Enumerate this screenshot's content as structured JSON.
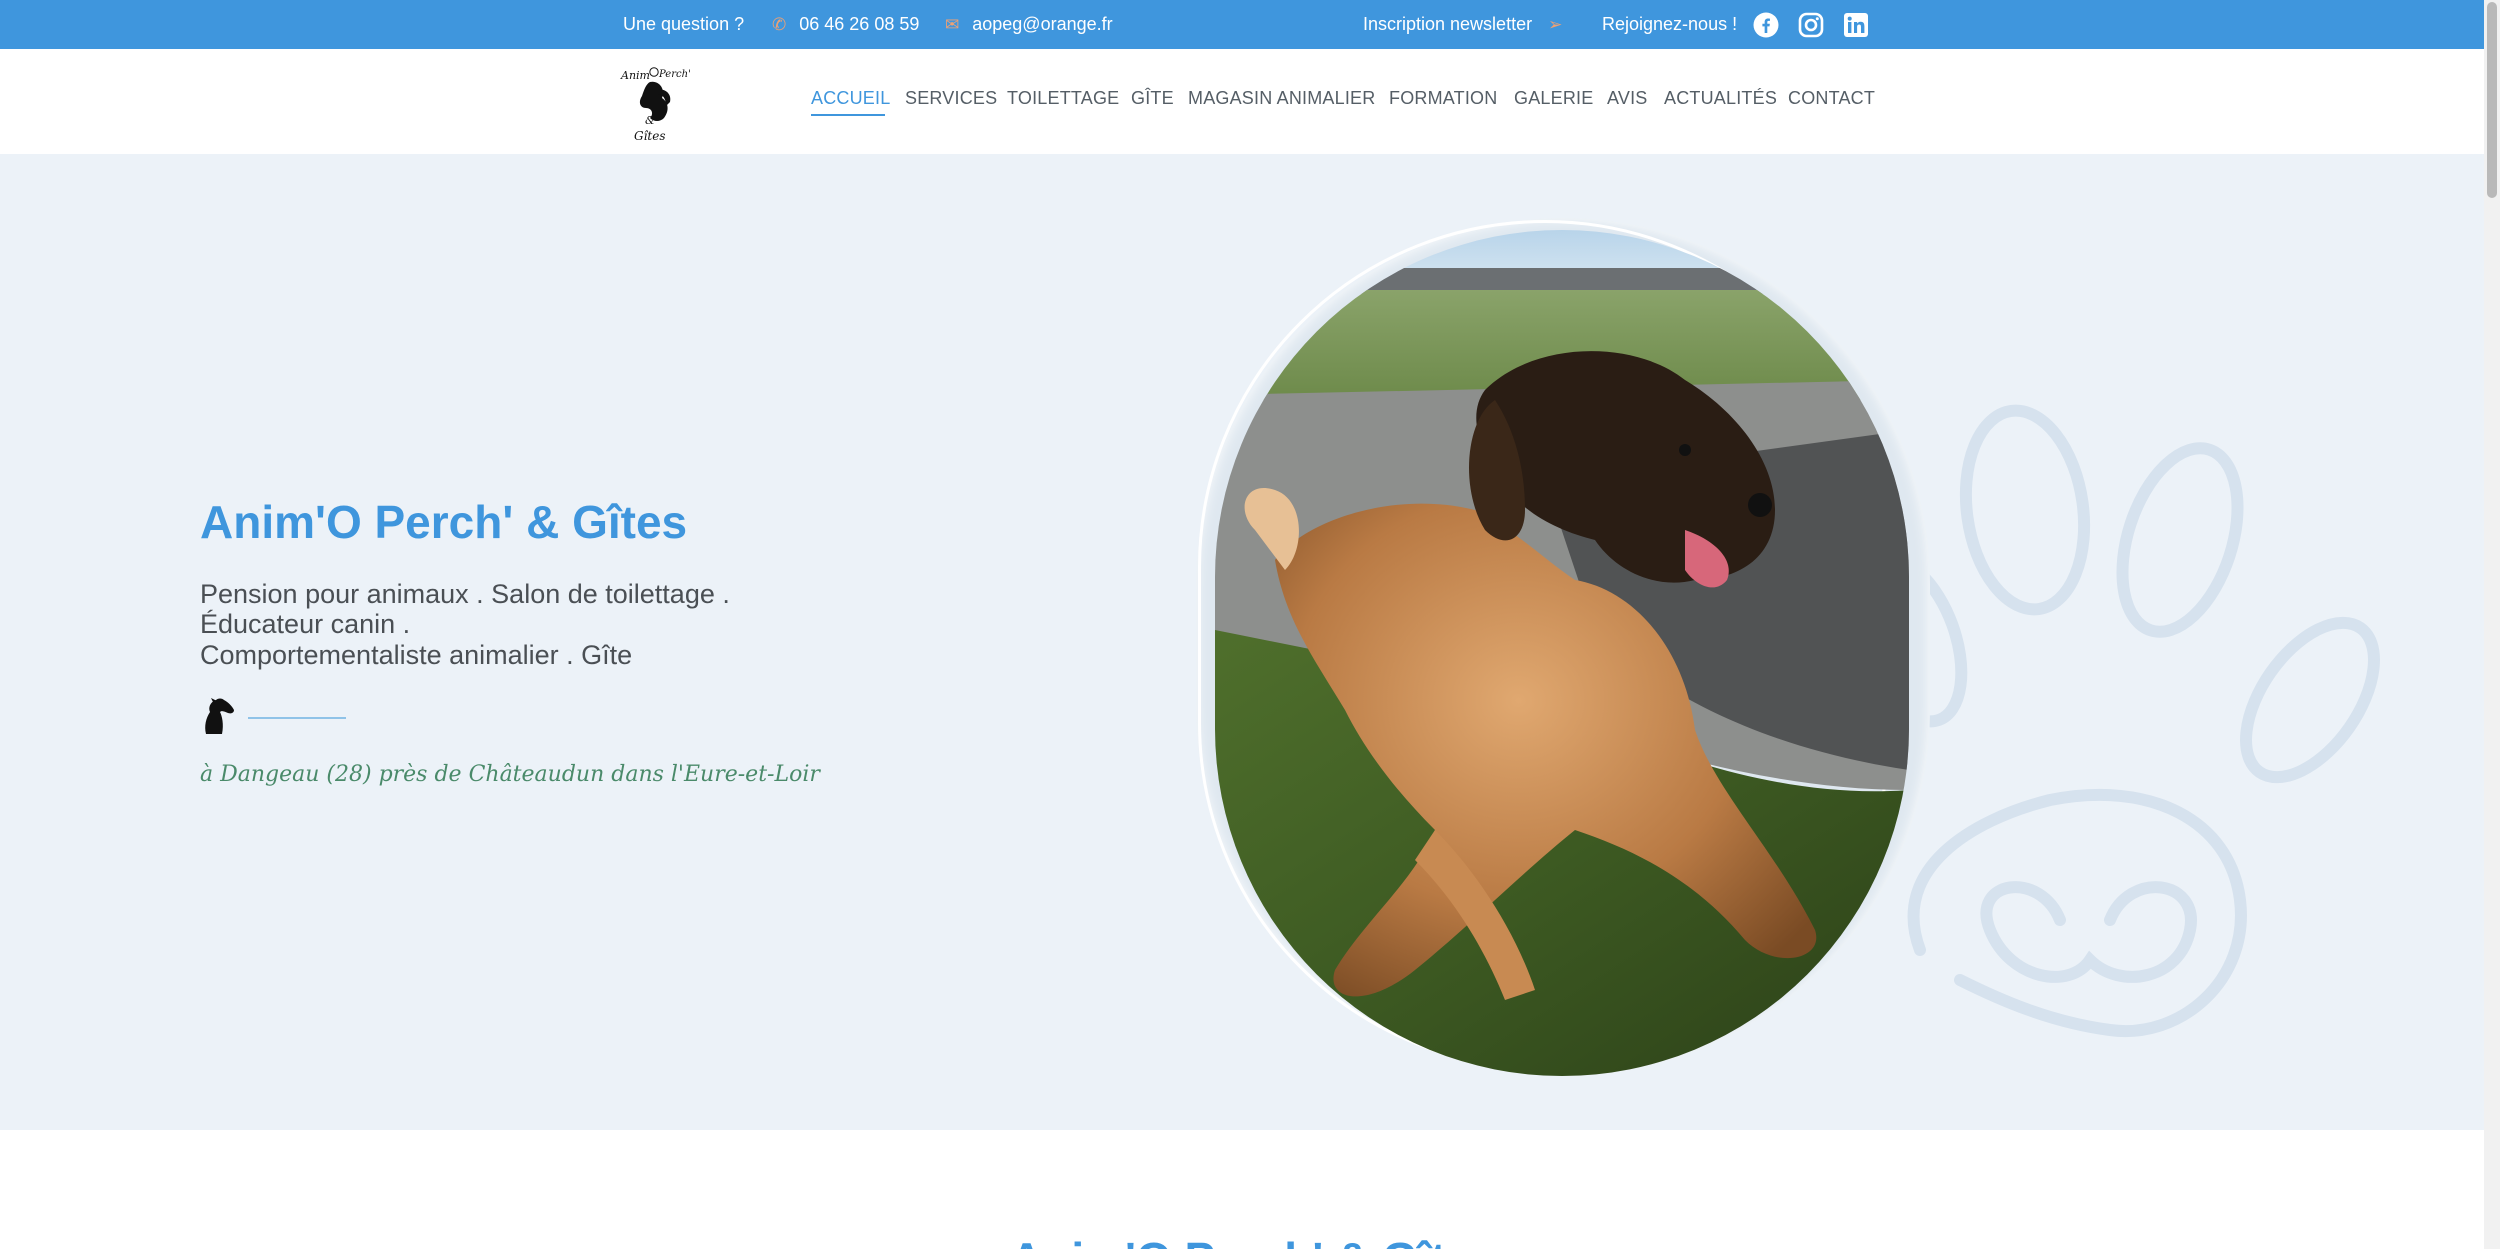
{
  "topbar": {
    "question": "Une question ?",
    "phone": "06 46 26 08 59",
    "email": "aopeg@orange.fr",
    "newsletter": "Inscription newsletter",
    "join": "Rejoignez-nous !",
    "social": [
      "facebook-icon",
      "instagram-icon",
      "linkedin-icon"
    ],
    "icon_color": "#f0a172",
    "bg_color": "#3f96dd"
  },
  "logo": {
    "alt": "Anim'O Perch' & Gîtes logo"
  },
  "nav": {
    "items": [
      "ACCUEIL",
      "SERVICES",
      "TOILETTAGE",
      "GÎTE",
      "MAGASIN ANIMALIER",
      "FORMATION",
      "GALERIE",
      "AVIS",
      "ACTUALITÉS",
      "CONTACT"
    ],
    "active": "ACCUEIL"
  },
  "hero": {
    "title": "Anim'O Perch' & Gîtes",
    "line1": "Pension pour animaux . Salon de toilettage .",
    "line2": "Éducateur canin .",
    "line3": "Comportementaliste animalier . Gîte",
    "tagline": "à Dangeau (28) près de Châteaudun dans l'Eure-et-Loir",
    "accent_color": "#3f96dd",
    "bg_color": "#ecf2f8"
  },
  "next_section": {
    "title": "Anim'O Perch' & Gîtes"
  }
}
